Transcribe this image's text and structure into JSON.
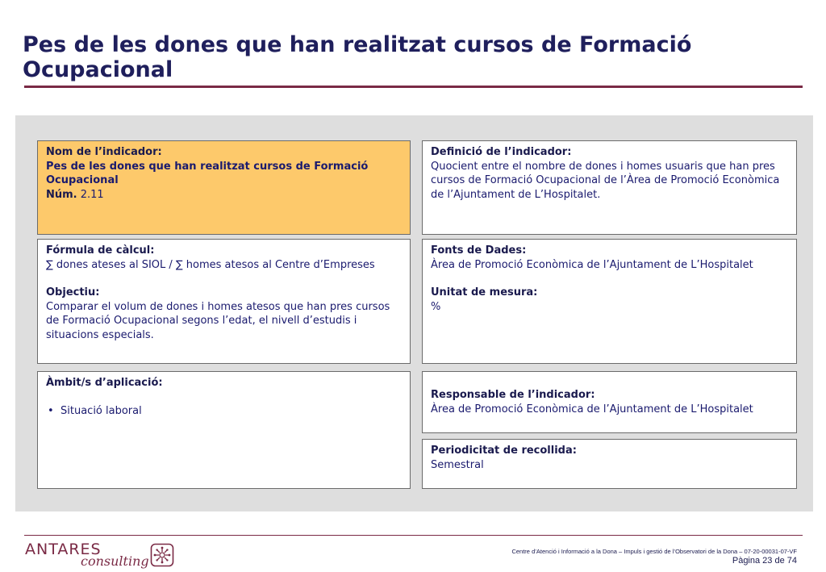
{
  "header": {
    "title": "Pes de les dones que han realitzat cursos de Formació Ocupacional"
  },
  "boxes": {
    "nom": {
      "label": "Nom de l’indicador:",
      "value": "Pes de les dones que han realitzat cursos de Formació Ocupacional",
      "num_label": "Núm.",
      "num_value": " 2.11"
    },
    "definicio": {
      "label": "Definició de l’indicador:",
      "value": "Quocient entre el nombre de dones i homes usuaris que han pres cursos de Formació Ocupacional de l’Àrea de Promoció Econòmica de l’Ajuntament de L’Hospitalet."
    },
    "formula": {
      "label": "Fórmula de càlcul:",
      "value": "∑ dones ateses al SIOL / ∑ homes atesos al Centre d’Empreses",
      "objectiu_label": "Objectiu:",
      "objectiu_value": "Comparar el volum de dones i homes atesos que han pres cursos de Formació Ocupacional segons l’edat, el nivell d’estudis i situacions especials."
    },
    "fonts": {
      "label": "Fonts de Dades:",
      "value": "Àrea de Promoció Econòmica de l’Ajuntament de L’Hospitalet",
      "unitat_label": "Unitat de mesura:",
      "unitat_value": "%"
    },
    "ambit": {
      "label": "Àmbit/s d’aplicació:",
      "items": [
        "Situació laboral"
      ]
    },
    "responsable": {
      "label": "Responsable de l’indicador:",
      "value": "Àrea de Promoció Econòmica de l’Ajuntament de L’Hospitalet"
    },
    "periodicitat": {
      "label": "Periodicitat de recollida:",
      "value": "Semestral"
    }
  },
  "footer": {
    "brand": "ANTARES",
    "brand_sub": "consulting",
    "text": "Centre d’Atenció i Informació a la Dona – Impuls i gestió de l’Observatori de la Dona – 07-20-00031-07-VF",
    "page": "Pàgina 23 de 74"
  },
  "colors": {
    "title": "#1f1f5c",
    "accent": "#7a2a45",
    "highlight_box": "#fdc96b",
    "panel": "#dedede"
  }
}
